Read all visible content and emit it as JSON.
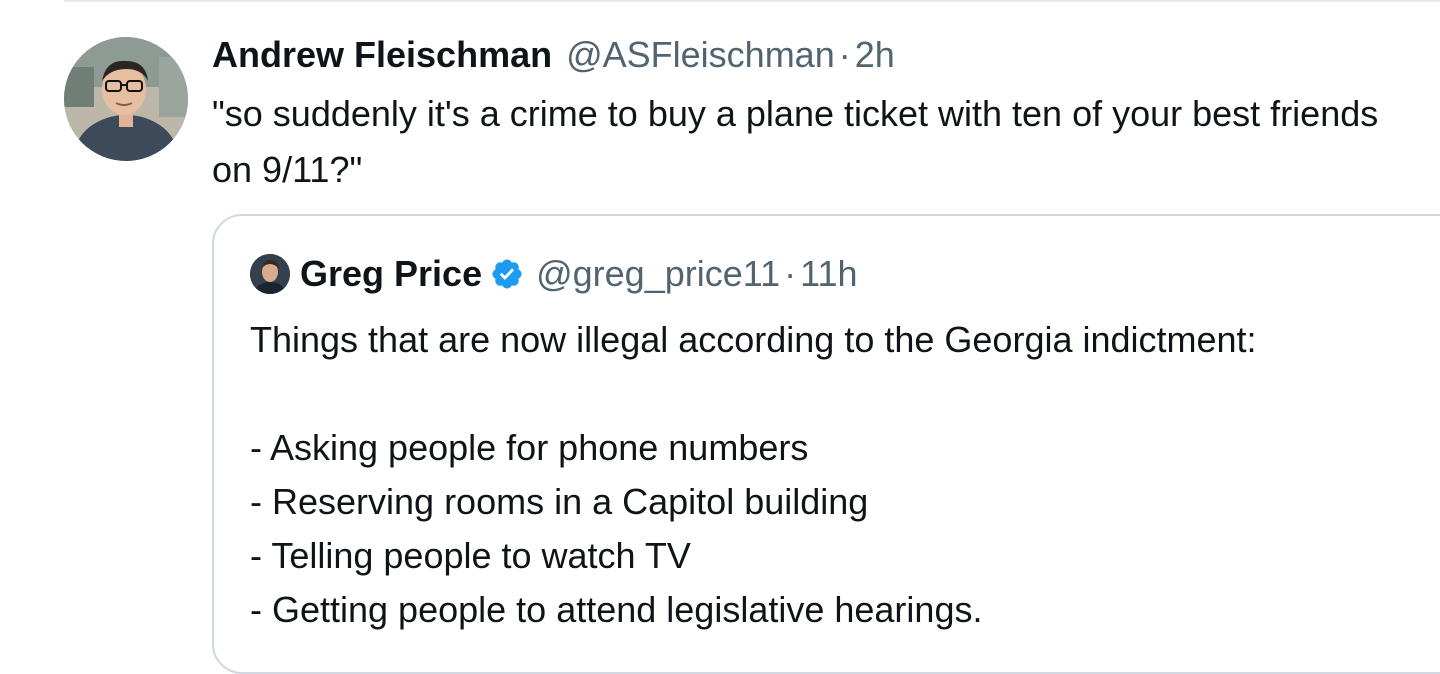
{
  "tweet": {
    "display_name": "Andrew Fleischman",
    "handle": "@ASFleischman",
    "separator": "·",
    "time": "2h",
    "avatar": "author-avatar-photo",
    "text": "\"so suddenly it's a crime to buy a plane ticket with ten of your best friends on 9/11?\""
  },
  "quote": {
    "display_name": "Greg Price",
    "verified_icon": "verified-badge-icon",
    "verified_color": "#1d9bf0",
    "handle": "@greg_price11",
    "separator": "·",
    "time": "11h",
    "avatar": "quoted-author-avatar-photo",
    "intro": "Things that are now illegal according to the Georgia indictment:",
    "items": [
      "- Asking people for phone numbers",
      "- Reserving rooms in a Capitol building",
      "- Telling people to watch TV",
      "- Getting people to attend legislative hearings."
    ]
  }
}
